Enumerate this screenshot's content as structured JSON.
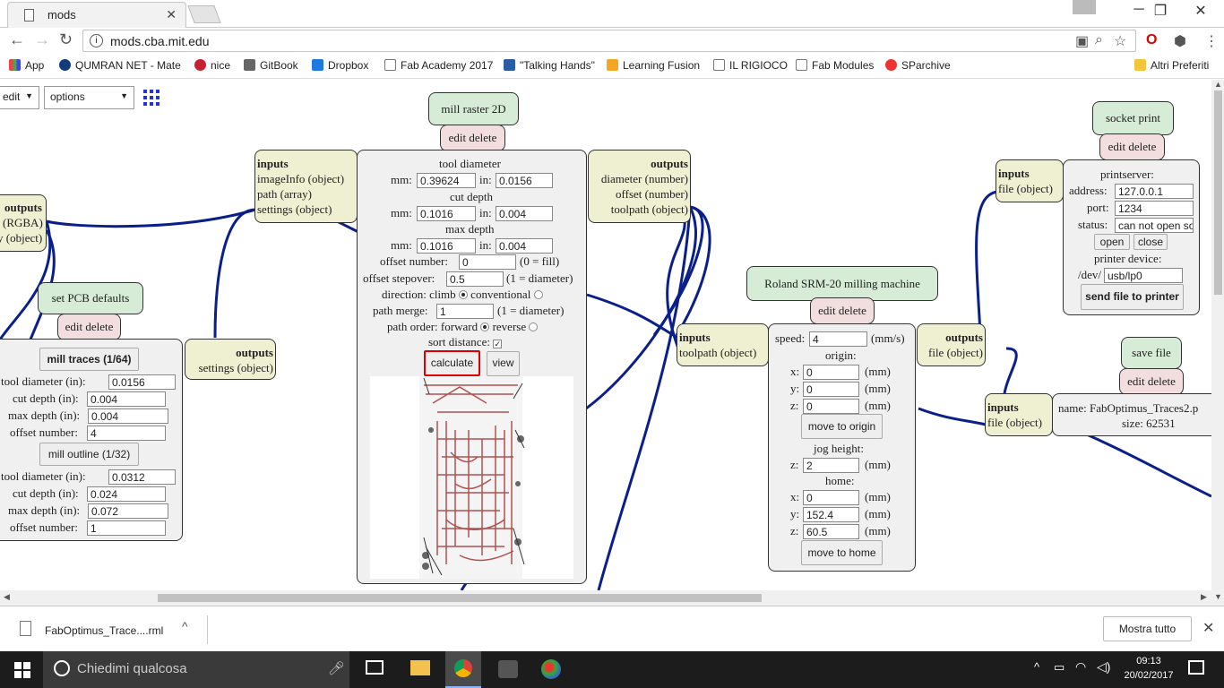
{
  "browser": {
    "tab_title": "mods",
    "url": "mods.cba.mit.edu"
  },
  "bookmarks": [
    "App",
    "QUMRAN NET - Mate",
    "nice",
    "GitBook",
    "Dropbox",
    "Fab Academy 2017",
    "\"Talking Hands\"",
    "Learning Fusion",
    "IL RIGIOCO",
    "Fab Modules",
    "SParchive",
    "Altri Preferiti"
  ],
  "toolbar": {
    "edit": "edit",
    "options": "options"
  },
  "png": {
    "outputs": "outputs",
    "l1": "(RGBA)",
    "l2": "y (object)"
  },
  "pcb": {
    "title": "set PCB defaults",
    "edit_delete": "edit delete",
    "mill_traces": "mill traces (1/64)",
    "mill_outline": "mill outline (1/32)",
    "labels": [
      "tool diameter (in):",
      "cut depth (in):",
      "max depth (in):",
      "offset number:"
    ],
    "traces": [
      "0.0156",
      "0.004",
      "0.004",
      "4"
    ],
    "outline": [
      "0.0312",
      "0.024",
      "0.072",
      "1"
    ],
    "outputs": "outputs",
    "settings": "settings (object)"
  },
  "mill": {
    "title": "mill raster 2D",
    "edit_delete": "edit delete",
    "inputs": "inputs",
    "in_list": [
      "imageInfo (object)",
      "path (array)",
      "settings (object)"
    ],
    "outputs": "outputs",
    "out_list": [
      "diameter (number)",
      "offset (number)",
      "toolpath (object)"
    ],
    "tool_diameter": "tool diameter",
    "mm": "mm:",
    "in": "in:",
    "td_mm": "0.39624",
    "td_in": "0.0156",
    "cut_depth": "cut depth",
    "cd_mm": "0.1016",
    "cd_in": "0.004",
    "max_depth": "max depth",
    "md_mm": "0.1016",
    "md_in": "0.004",
    "offset_number": "offset number:",
    "on_val": "0",
    "on_note": "(0 = fill)",
    "offset_stepover": "offset stepover:",
    "os_val": "0.5",
    "os_note": "(1 = diameter)",
    "direction": "direction: climb",
    "conventional": "conventional",
    "path_merge": "path merge:",
    "pm_val": "1",
    "pm_note": "(1 = diameter)",
    "path_order": "path order: forward",
    "reverse": "reverse",
    "sort_distance": "sort distance:",
    "calculate": "calculate",
    "view": "view"
  },
  "roland": {
    "title": "Roland SRM-20 milling machine",
    "edit_delete": "edit delete",
    "inputs": "inputs",
    "toolpath": "toolpath (object)",
    "speed": "speed:",
    "speed_val": "4",
    "speed_unit": "(mm/s)",
    "origin": "origin:",
    "x": "x:",
    "y": "y:",
    "z": "z:",
    "mm": "(mm)",
    "ox": "0",
    "oy": "0",
    "oz": "0",
    "move_origin": "move to origin",
    "jog": "jog height:",
    "jz": "2",
    "home": "home:",
    "hx": "0",
    "hy": "152.4",
    "hz": "60.5",
    "move_home": "move to home",
    "outputs": "outputs",
    "file": "file (object)"
  },
  "socket": {
    "title": "socket print",
    "edit_delete": "edit delete",
    "inputs": "inputs",
    "file": "file (object)",
    "printserver": "printserver:",
    "address": "address:",
    "address_val": "127.0.0.1",
    "port": "port:",
    "port_val": "1234",
    "status": "status:",
    "status_val": "can not open so",
    "open": "open",
    "close": "close",
    "printer_device": "printer device:",
    "dev": "/dev/",
    "dev_val": "usb/lp0",
    "send": "send file to printer"
  },
  "save": {
    "title": "save file",
    "edit_delete": "edit delete",
    "inputs": "inputs",
    "file": "file (object)",
    "name": "name: FabOptimus_Traces2.p",
    "size": "size: 62531"
  },
  "download": {
    "file": "FabOptimus_Trace....rml",
    "show_all": "Mostra tutto"
  },
  "taskbar": {
    "search": "Chiedimi qualcosa",
    "time": "09:13",
    "date": "20/02/2017"
  }
}
